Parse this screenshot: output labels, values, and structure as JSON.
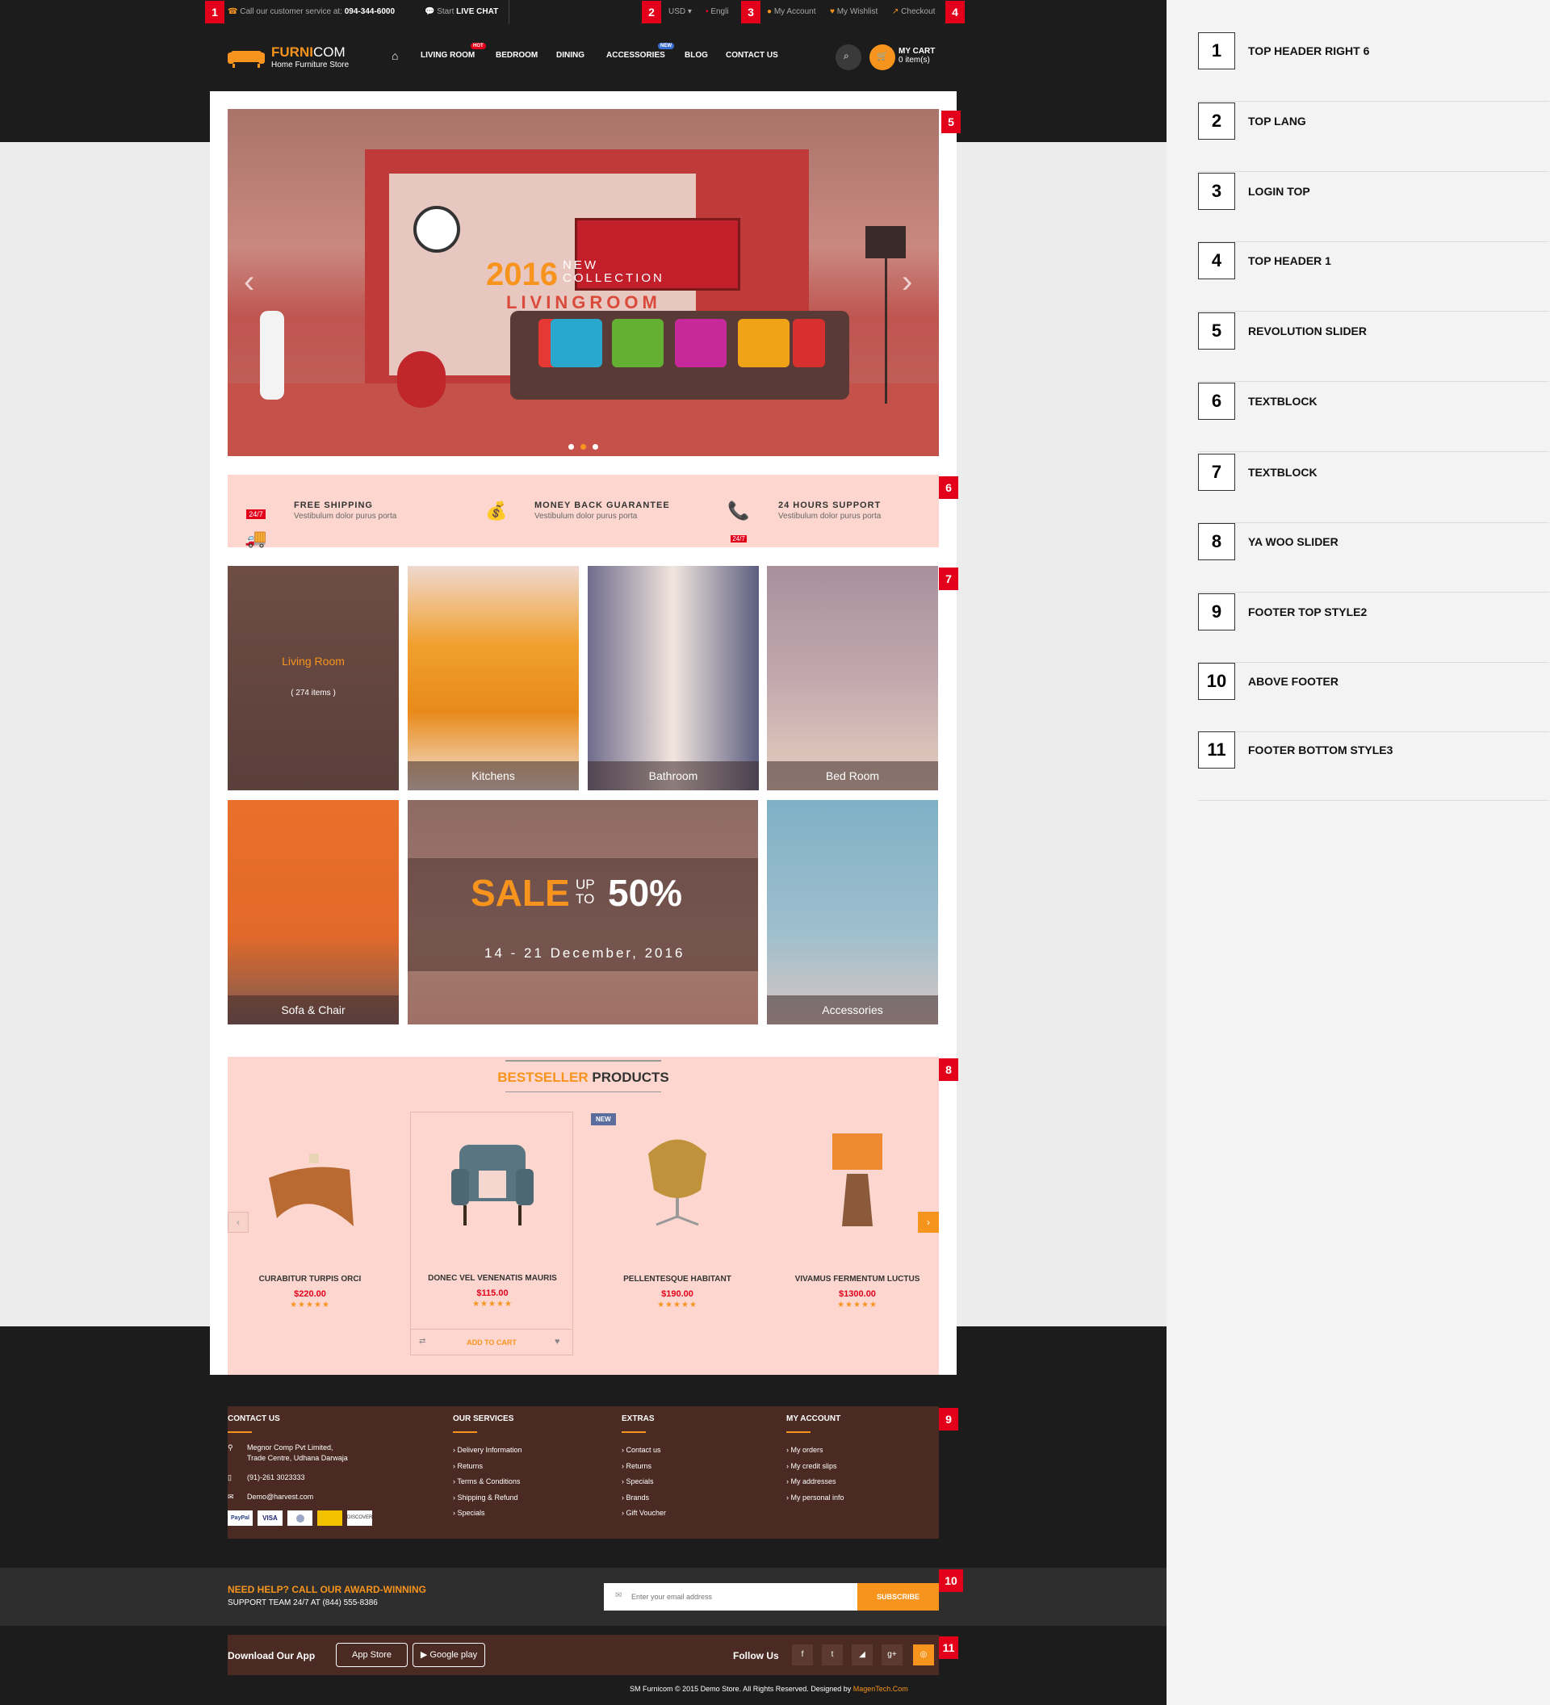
{
  "topbar": {
    "service_label": "Call our customer service at:",
    "phone": "094-344-6000",
    "live_chat_label": "Start",
    "live_chat_bold": "LIVE CHAT",
    "currency": "USD",
    "language": "Engli",
    "account": "My Account",
    "wishlist": "My Wishlist",
    "checkout": "Checkout"
  },
  "brand": {
    "name_a": "FURNI",
    "name_b": "COM",
    "tagline": "Home Furniture Store"
  },
  "nav": {
    "items": [
      "LIVING ROOM",
      "BEDROOM",
      "DINING",
      "ACCESSORIES",
      "BLOG",
      "CONTACT US"
    ],
    "hot": "HOT",
    "new": "NEW"
  },
  "cart": {
    "label": "MY CART",
    "count": "0 item(s)"
  },
  "hero": {
    "year": "2016",
    "line1": "NEW",
    "line2": "COLLECTION",
    "title": "LIVINGROOM"
  },
  "strip": [
    {
      "title": "FREE SHIPPING",
      "sub": "Vestibulum dolor purus porta",
      "badge": "24/7"
    },
    {
      "title": "MONEY BACK GUARANTEE",
      "sub": "Vestibulum dolor purus porta"
    },
    {
      "title": "24 HOURS SUPPORT",
      "sub": "Vestibulum dolor purus porta",
      "badge": "24/7"
    }
  ],
  "categories": {
    "living": "Living Room",
    "living_count": "( 274 items )",
    "kitchens": "Kitchens",
    "bathroom": "Bathroom",
    "bedroom": "Bed Room",
    "sofa": "Sofa & Chair",
    "accessories": "Accessories"
  },
  "sale": {
    "word": "SALE",
    "up": "UP",
    "to": "TO",
    "pct": "50%",
    "dates": "14 - 21 December, 2016"
  },
  "best": {
    "title_a": "BESTSELLER",
    "title_b": " PRODUCTS",
    "new_badge": "NEW",
    "add_to_cart": "ADD TO CART",
    "products": [
      {
        "name": "CURABITUR TURPIS ORCI",
        "price": "$220.00"
      },
      {
        "name": "DONEC VEL VENENATIS MAURIS",
        "price": "$115.00"
      },
      {
        "name": "PELLENTESQUE HABITANT",
        "price": "$190.00"
      },
      {
        "name": "VIVAMUS FERMENTUM LUCTUS",
        "price": "$1300.00"
      }
    ],
    "stars": "★★★★★"
  },
  "footer": {
    "contact": {
      "h": "CONTACT US",
      "addr1": "Megnor Comp Pvt Limited,",
      "addr2": "Trade Centre, Udhana Darwaja",
      "phone": "(91)-261 3023333",
      "email": "Demo@harvest.com"
    },
    "services": {
      "h": "OUR SERVICES",
      "items": [
        "Delivery Information",
        "Returns",
        "Terms & Conditions",
        "Shipping & Refund",
        "Specials"
      ]
    },
    "extras": {
      "h": "EXTRAS",
      "items": [
        "Contact us",
        "Returns",
        "Specials",
        "Brands",
        "Gift Voucher"
      ]
    },
    "account": {
      "h": "MY ACCOUNT",
      "items": [
        "My orders",
        "My credit slips",
        "My addresses",
        "My personal info"
      ]
    },
    "payments": [
      "PayPal",
      "VISA",
      "",
      "",
      "DISCOVER"
    ]
  },
  "above": {
    "line1": "NEED HELP? CALL OUR AWARD-WINNING",
    "line2": "SUPPORT TEAM 24/7 AT (844) 555-8386",
    "placeholder": "Enter your email address",
    "subscribe": "SUBSCRIBE"
  },
  "bottom": {
    "download": "Download Our App",
    "appstore": "App Store",
    "googleplay": "Google play",
    "follow": "Follow Us",
    "copy": "SM Furnicom © 2015 Demo Store. All Rights Reserved. Designed by",
    "copy_link": "MagenTech.Com"
  },
  "markers": [
    "1",
    "2",
    "3",
    "4",
    "5",
    "6",
    "7",
    "8",
    "9",
    "10",
    "11"
  ],
  "legend": [
    {
      "n": "1",
      "t": "TOP HEADER RIGHT 6"
    },
    {
      "n": "2",
      "t": "TOP LANG"
    },
    {
      "n": "3",
      "t": "LOGIN TOP"
    },
    {
      "n": "4",
      "t": "TOP HEADER 1"
    },
    {
      "n": "5",
      "t": "REVOLUTION SLIDER"
    },
    {
      "n": "6",
      "t": "TEXTBLOCK"
    },
    {
      "n": "7",
      "t": "TEXTBLOCK"
    },
    {
      "n": "8",
      "t": "YA WOO SLIDER"
    },
    {
      "n": "9",
      "t": "FOOTER TOP STYLE2"
    },
    {
      "n": "10",
      "t": "ABOVE FOOTER"
    },
    {
      "n": "11",
      "t": "FOOTER BOTTOM STYLE3"
    }
  ],
  "colors": {
    "accent": "#f7941d",
    "marker": "#e3001b",
    "dark": "#1c1c1c",
    "footer": "#4a2a22",
    "pink": "#fdd7cf"
  }
}
